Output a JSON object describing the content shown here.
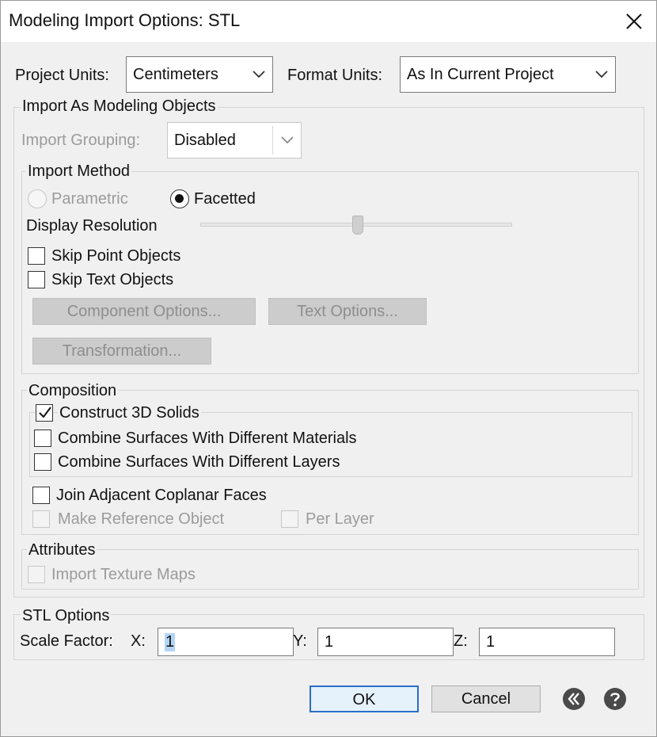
{
  "window": {
    "title": "Modeling Import Options: STL"
  },
  "units": {
    "project_units_label": "Project Units:",
    "project_units_value": "Centimeters",
    "format_units_label": "Format Units:",
    "format_units_value": "As In Current Project"
  },
  "import_as": {
    "group_title": "Import As Modeling Objects",
    "grouping_label": "Import Grouping:",
    "grouping_value": "Disabled",
    "method": {
      "group_title": "Import Method",
      "parametric_label": "Parametric",
      "facetted_label": "Facetted",
      "selected": "Facetted",
      "display_resolution_label": "Display Resolution",
      "skip_point_label": "Skip Point Objects",
      "skip_text_label": "Skip Text Objects",
      "component_options_label": "Component Options...",
      "text_options_label": "Text Options...",
      "transformation_label": "Transformation..."
    },
    "composition": {
      "group_title": "Composition",
      "construct_3d_label": "Construct 3D Solids",
      "construct_3d_checked": true,
      "combine_materials_label": "Combine Surfaces With Different Materials",
      "combine_layers_label": "Combine Surfaces With Different Layers",
      "join_coplanar_label": "Join Adjacent Coplanar Faces",
      "make_reference_label": "Make Reference Object",
      "per_layer_label": "Per Layer"
    },
    "attributes": {
      "group_title": "Attributes",
      "import_texture_label": "Import Texture Maps"
    }
  },
  "stl_options": {
    "group_title": "STL Options",
    "scale_factor_label": "Scale Factor:",
    "x_label": "X:",
    "x_value": "1",
    "y_label": "Y:",
    "y_value": "1",
    "z_label": "Z:",
    "z_value": "1"
  },
  "footer": {
    "ok_label": "OK",
    "cancel_label": "Cancel",
    "back_icon": "back-arrow-icon",
    "help_icon": "help-icon"
  },
  "colors": {
    "dialog_bg": "#f0f0f0",
    "disabled_text": "#9b9b9b",
    "default_button_border": "#2a6ec6",
    "selection": "#b3d4f5"
  }
}
